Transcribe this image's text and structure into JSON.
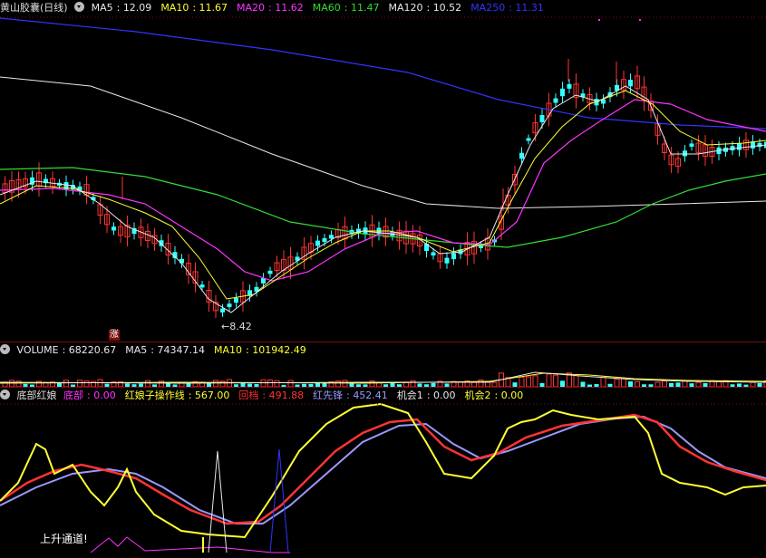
{
  "main": {
    "title": "黄山胶囊(日线)",
    "indicators": [
      {
        "name": "MA5",
        "value": "12.09",
        "color": "#e8e8e8"
      },
      {
        "name": "MA10",
        "value": "11.67",
        "color": "#ffff33"
      },
      {
        "name": "MA20",
        "value": "11.62",
        "color": "#ff33ff"
      },
      {
        "name": "MA60",
        "value": "11.47",
        "color": "#33dd33"
      },
      {
        "name": "MA120",
        "value": "10.52",
        "color": "#e8e8e8"
      },
      {
        "name": "MA250",
        "value": "11.31",
        "color": "#3333ff"
      }
    ],
    "low_label": "8.42",
    "badge": "涨"
  },
  "volume": {
    "title": "VOLUME",
    "indicators": [
      {
        "name": "VOLUME",
        "value": "68220.67",
        "color": "#e8e8e8"
      },
      {
        "name": "MA5",
        "value": "74347.14",
        "color": "#e8e8e8"
      },
      {
        "name": "MA10",
        "value": "101942.49",
        "color": "#ffff33"
      }
    ]
  },
  "oscillator": {
    "title": "底部红娘",
    "indicators": [
      {
        "name": "底部",
        "value": "0.00",
        "color": "#ff33ff"
      },
      {
        "name": "红娘子操作线",
        "value": "567.00",
        "color": "#ffff33"
      },
      {
        "name": "回档",
        "value": "491.88",
        "color": "#ff3333"
      },
      {
        "name": "红先锋",
        "value": "452.41",
        "color": "#9999ff"
      },
      {
        "name": "机会1",
        "value": "0.00",
        "color": "#e8e8e8"
      },
      {
        "name": "机会2",
        "value": "0.00",
        "color": "#ffff33"
      }
    ],
    "note": "上升通道!"
  },
  "colors": {
    "up": "#ff3333",
    "down": "#33ffff",
    "background": "#000000",
    "separator": "#7a1010"
  }
}
